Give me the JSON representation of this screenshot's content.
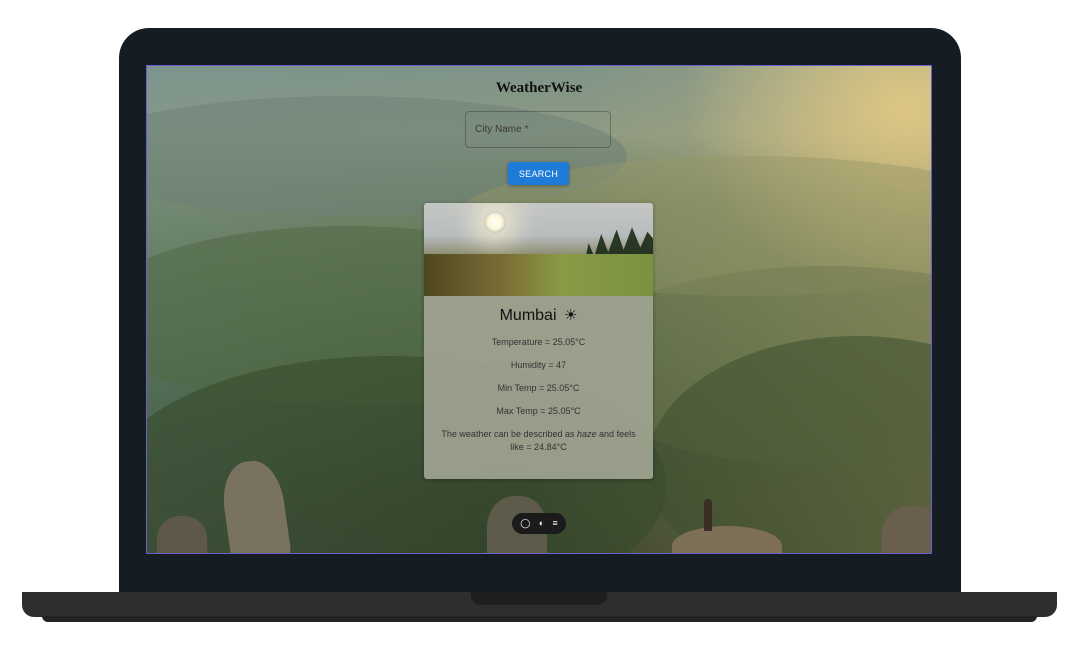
{
  "app": {
    "title": "WeatherWise"
  },
  "search": {
    "placeholder": "City Name *",
    "button_label": "SEARCH"
  },
  "weather_card": {
    "city": "Mumbai",
    "weather_icon": "☀",
    "temperature": "Temperature = 25.05°C",
    "humidity": "Humidity = 47",
    "min_temp": "Min Temp = 25.05°C",
    "max_temp": "Max Temp = 25.05°C",
    "description_prefix": "The weather can be described as ",
    "description_word": "haze",
    "description_suffix": " and feels like = 24.84°C"
  },
  "toolbar": {
    "icons": [
      "chat-icon",
      "toggle-icon",
      "menu-icon"
    ],
    "chat_glyph": "◯",
    "toggle_glyph": "◐",
    "menu_glyph": "≡"
  },
  "colors": {
    "accent": "#1e7bd8",
    "laptop_frame": "#161c24",
    "card_bg": "#a0a491"
  }
}
